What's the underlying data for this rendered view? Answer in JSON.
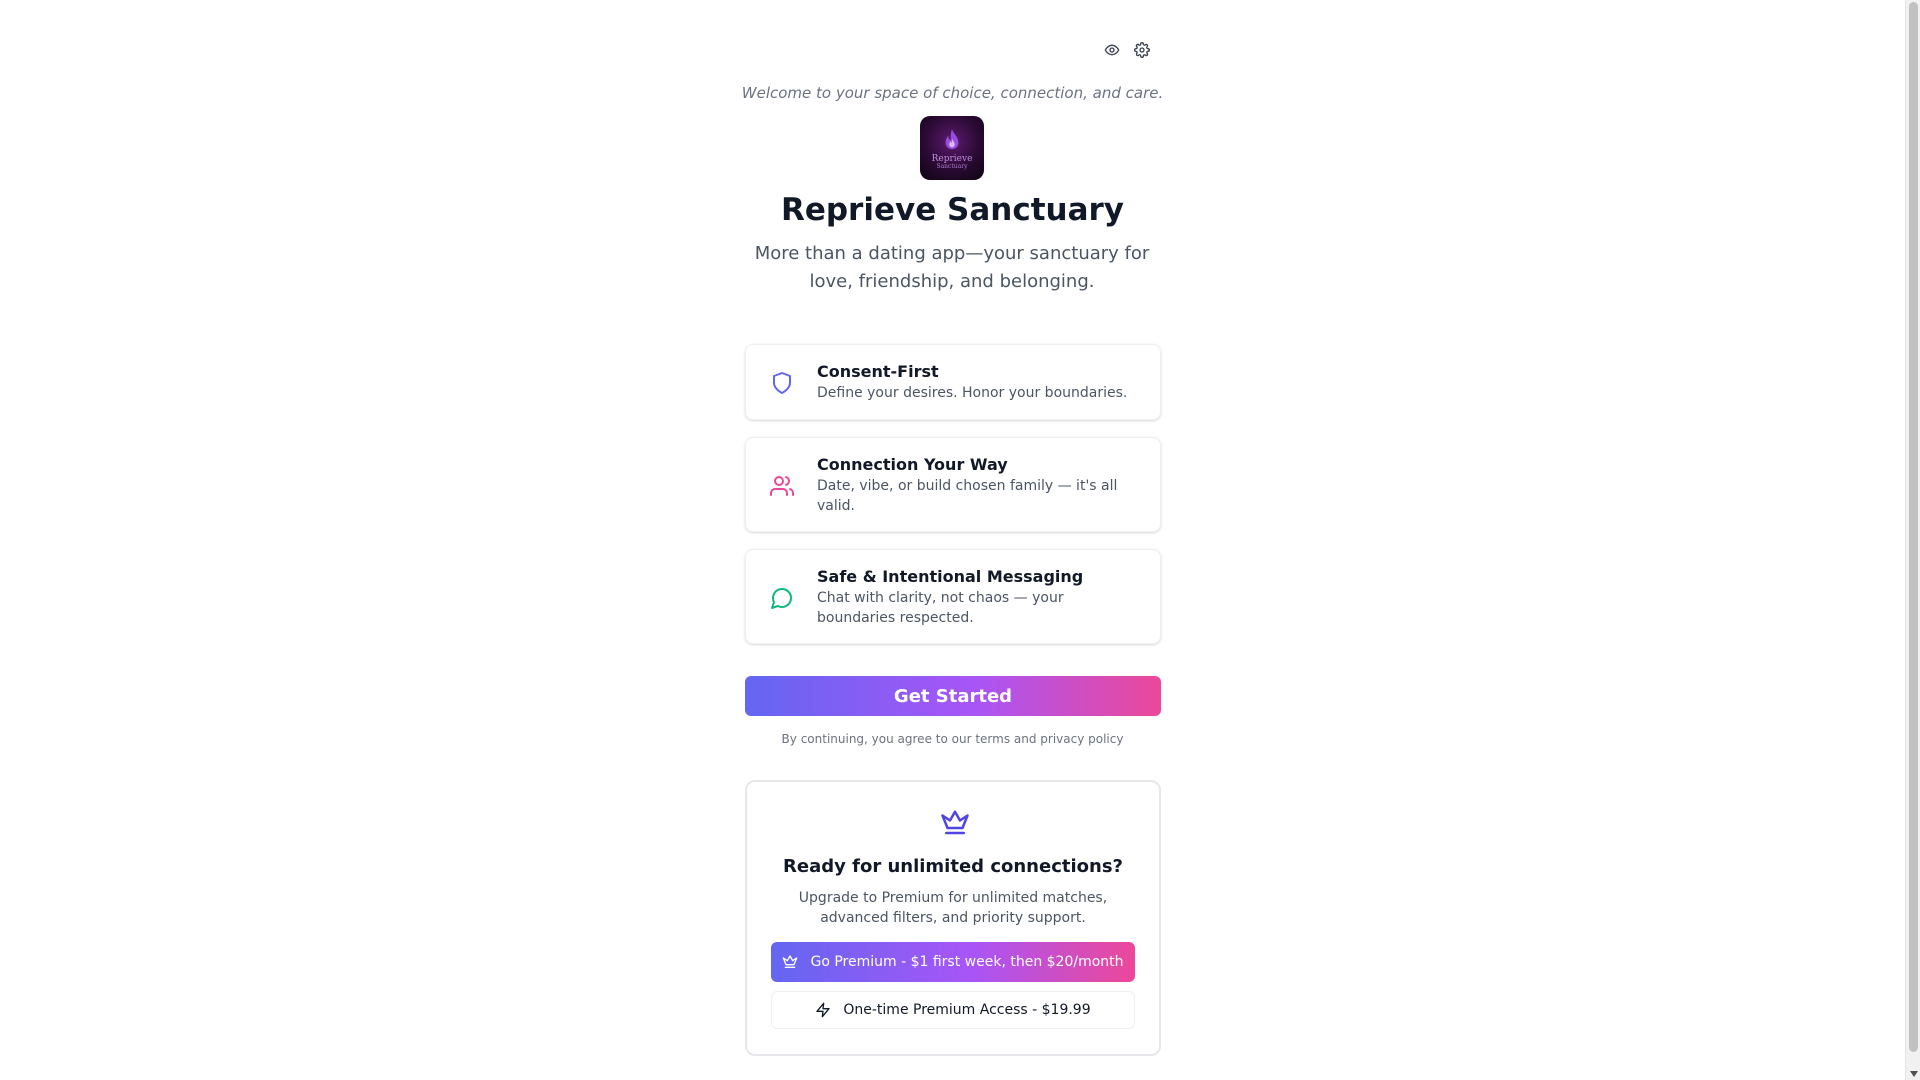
{
  "header": {
    "icons": [
      "eye-icon",
      "settings-gear-icon"
    ]
  },
  "welcome_text": "Welcome to your space of choice, connection, and care.",
  "logo": {
    "text": "Reprieve",
    "subtext": "Sanctuary",
    "icon": "flame-icon"
  },
  "title": "Reprieve Sanctuary",
  "subtitle": "More than a dating app—your sanctuary for love, friendship, and belonging.",
  "features": [
    {
      "icon": "shield-icon",
      "color": "#6366f1",
      "title": "Consent-First",
      "description": "Define your desires. Honor your boundaries."
    },
    {
      "icon": "users-icon",
      "color": "#ec4899",
      "title": "Connection Your Way",
      "description": "Date, vibe, or build chosen family — it's all valid."
    },
    {
      "icon": "message-circle-icon",
      "color": "#10b981",
      "title": "Safe & Intentional Messaging",
      "description": "Chat with clarity, not chaos — your boundaries respected."
    }
  ],
  "cta": {
    "label": "Get Started"
  },
  "terms_text": "By continuing, you agree to our terms and privacy policy",
  "premium": {
    "icon": "crown-icon",
    "title": "Ready for unlimited connections?",
    "description": "Upgrade to Premium for unlimited matches, advanced filters, and priority support.",
    "primary_button": {
      "icon": "crown-icon",
      "label": "Go Premium - $1 first week, then $20/month"
    },
    "secondary_button": {
      "icon": "zap-icon",
      "label": "One-time Premium Access - $19.99"
    }
  },
  "colors": {
    "accent_start": "#6366f1",
    "accent_mid": "#a855f7",
    "accent_end": "#ec4899",
    "crown": "#4f46e5"
  }
}
